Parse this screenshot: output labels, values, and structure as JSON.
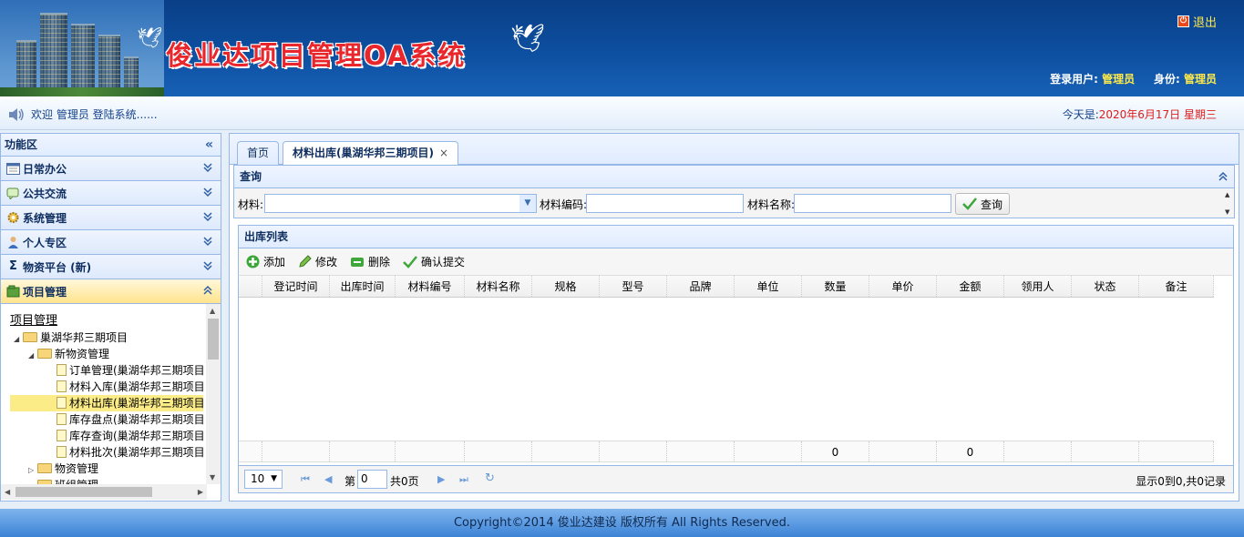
{
  "header": {
    "title": "俊业达项目管理OA系统",
    "logout_label": "退出",
    "user_label": "登录用户:",
    "user_value": "管理员",
    "role_label": "身份:",
    "role_value": "管理员"
  },
  "welcome": {
    "message": "欢迎 管理员 登陆系统......",
    "date_label": "今天是:",
    "date_value": "2020年6月17日 星期三"
  },
  "sidebar": {
    "title": "功能区",
    "sections": [
      {
        "label": "日常办公",
        "icon": "calendar-icon"
      },
      {
        "label": "公共交流",
        "icon": "chat-icon"
      },
      {
        "label": "系统管理",
        "icon": "gear-icon"
      },
      {
        "label": "个人专区",
        "icon": "user-icon"
      },
      {
        "label": "物资平台 (新)",
        "icon": "sigma-icon"
      },
      {
        "label": "项目管理",
        "icon": "folder-icon"
      }
    ],
    "tree": {
      "root": "项目管理",
      "project": "巢湖华邦三期项目",
      "group": "新物资管理",
      "leaves": [
        "订单管理(巢湖华邦三期项目)",
        "材料入库(巢湖华邦三期项目)",
        "材料出库(巢湖华邦三期项目)",
        "库存盘点(巢湖华邦三期项目)",
        "库存查询(巢湖华邦三期项目)",
        "材料批次(巢湖华邦三期项目)"
      ],
      "other1": "物资管理",
      "other2": "班组管理"
    }
  },
  "tabs": [
    {
      "label": "首页"
    },
    {
      "label": "材料出库(巢湖华邦三期项目)",
      "close": "×"
    }
  ],
  "query": {
    "title": "查询",
    "material_label": "材料:",
    "code_label": "材料编码:",
    "name_label": "材料名称:",
    "search_button": "查询"
  },
  "list": {
    "title": "出库列表",
    "toolbar": [
      "添加",
      "修改",
      "删除",
      "确认提交"
    ],
    "columns": [
      "登记时间",
      "出库时间",
      "材料编号",
      "材料名称",
      "规格",
      "型号",
      "品牌",
      "单位",
      "数量",
      "单价",
      "金额",
      "领用人",
      "状态",
      "备注"
    ],
    "footer_qty": "0",
    "footer_amount": "0"
  },
  "pager": {
    "page_size": "10",
    "page_label": "第",
    "page_value": "0",
    "total_pages": "共0页",
    "summary": "显示0到0,共0记录"
  },
  "footer": {
    "copyright": "Copyright©2014 俊业达建设 版权所有 All Rights Reserved."
  }
}
